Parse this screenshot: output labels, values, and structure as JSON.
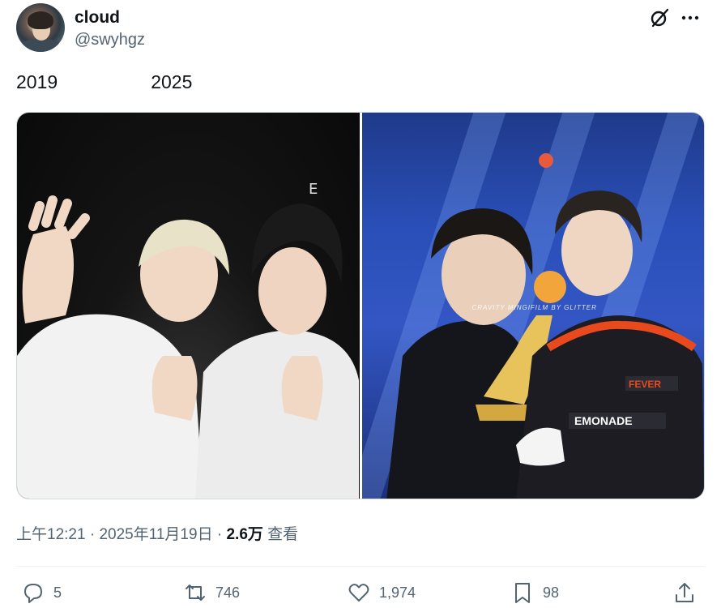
{
  "author": {
    "display_name": "cloud",
    "handle": "@swyhgz"
  },
  "tweet": {
    "text": "2019                  2025"
  },
  "media": {
    "watermark": "CRAVITY MINGIFILM BY GLITTER"
  },
  "meta": {
    "time": "上午12:21",
    "separator": " · ",
    "date": "2025年11月19日",
    "separator2": " · ",
    "views_count": "2.6万",
    "views_label": " 查看"
  },
  "actions": {
    "replies": "5",
    "reposts": "746",
    "likes": "1,974",
    "bookmarks": "98"
  },
  "icons": {
    "grok": "grok-icon",
    "more": "more-icon",
    "reply": "reply-icon",
    "repost": "repost-icon",
    "like": "heart-icon",
    "bookmark": "bookmark-icon",
    "share": "share-icon"
  },
  "colors": {
    "text_primary": "#0f1419",
    "text_secondary": "#536471",
    "border": "#cfd9de"
  }
}
